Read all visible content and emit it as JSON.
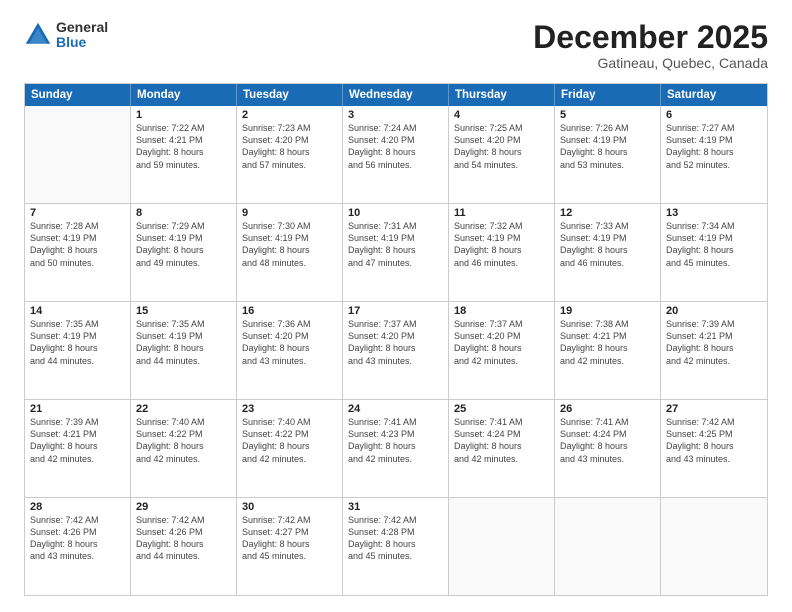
{
  "logo": {
    "general": "General",
    "blue": "Blue"
  },
  "title": "December 2025",
  "location": "Gatineau, Quebec, Canada",
  "header_days": [
    "Sunday",
    "Monday",
    "Tuesday",
    "Wednesday",
    "Thursday",
    "Friday",
    "Saturday"
  ],
  "weeks": [
    [
      {
        "day": "",
        "lines": []
      },
      {
        "day": "1",
        "lines": [
          "Sunrise: 7:22 AM",
          "Sunset: 4:21 PM",
          "Daylight: 8 hours",
          "and 59 minutes."
        ]
      },
      {
        "day": "2",
        "lines": [
          "Sunrise: 7:23 AM",
          "Sunset: 4:20 PM",
          "Daylight: 8 hours",
          "and 57 minutes."
        ]
      },
      {
        "day": "3",
        "lines": [
          "Sunrise: 7:24 AM",
          "Sunset: 4:20 PM",
          "Daylight: 8 hours",
          "and 56 minutes."
        ]
      },
      {
        "day": "4",
        "lines": [
          "Sunrise: 7:25 AM",
          "Sunset: 4:20 PM",
          "Daylight: 8 hours",
          "and 54 minutes."
        ]
      },
      {
        "day": "5",
        "lines": [
          "Sunrise: 7:26 AM",
          "Sunset: 4:19 PM",
          "Daylight: 8 hours",
          "and 53 minutes."
        ]
      },
      {
        "day": "6",
        "lines": [
          "Sunrise: 7:27 AM",
          "Sunset: 4:19 PM",
          "Daylight: 8 hours",
          "and 52 minutes."
        ]
      }
    ],
    [
      {
        "day": "7",
        "lines": [
          "Sunrise: 7:28 AM",
          "Sunset: 4:19 PM",
          "Daylight: 8 hours",
          "and 50 minutes."
        ]
      },
      {
        "day": "8",
        "lines": [
          "Sunrise: 7:29 AM",
          "Sunset: 4:19 PM",
          "Daylight: 8 hours",
          "and 49 minutes."
        ]
      },
      {
        "day": "9",
        "lines": [
          "Sunrise: 7:30 AM",
          "Sunset: 4:19 PM",
          "Daylight: 8 hours",
          "and 48 minutes."
        ]
      },
      {
        "day": "10",
        "lines": [
          "Sunrise: 7:31 AM",
          "Sunset: 4:19 PM",
          "Daylight: 8 hours",
          "and 47 minutes."
        ]
      },
      {
        "day": "11",
        "lines": [
          "Sunrise: 7:32 AM",
          "Sunset: 4:19 PM",
          "Daylight: 8 hours",
          "and 46 minutes."
        ]
      },
      {
        "day": "12",
        "lines": [
          "Sunrise: 7:33 AM",
          "Sunset: 4:19 PM",
          "Daylight: 8 hours",
          "and 46 minutes."
        ]
      },
      {
        "day": "13",
        "lines": [
          "Sunrise: 7:34 AM",
          "Sunset: 4:19 PM",
          "Daylight: 8 hours",
          "and 45 minutes."
        ]
      }
    ],
    [
      {
        "day": "14",
        "lines": [
          "Sunrise: 7:35 AM",
          "Sunset: 4:19 PM",
          "Daylight: 8 hours",
          "and 44 minutes."
        ]
      },
      {
        "day": "15",
        "lines": [
          "Sunrise: 7:35 AM",
          "Sunset: 4:19 PM",
          "Daylight: 8 hours",
          "and 44 minutes."
        ]
      },
      {
        "day": "16",
        "lines": [
          "Sunrise: 7:36 AM",
          "Sunset: 4:20 PM",
          "Daylight: 8 hours",
          "and 43 minutes."
        ]
      },
      {
        "day": "17",
        "lines": [
          "Sunrise: 7:37 AM",
          "Sunset: 4:20 PM",
          "Daylight: 8 hours",
          "and 43 minutes."
        ]
      },
      {
        "day": "18",
        "lines": [
          "Sunrise: 7:37 AM",
          "Sunset: 4:20 PM",
          "Daylight: 8 hours",
          "and 42 minutes."
        ]
      },
      {
        "day": "19",
        "lines": [
          "Sunrise: 7:38 AM",
          "Sunset: 4:21 PM",
          "Daylight: 8 hours",
          "and 42 minutes."
        ]
      },
      {
        "day": "20",
        "lines": [
          "Sunrise: 7:39 AM",
          "Sunset: 4:21 PM",
          "Daylight: 8 hours",
          "and 42 minutes."
        ]
      }
    ],
    [
      {
        "day": "21",
        "lines": [
          "Sunrise: 7:39 AM",
          "Sunset: 4:21 PM",
          "Daylight: 8 hours",
          "and 42 minutes."
        ]
      },
      {
        "day": "22",
        "lines": [
          "Sunrise: 7:40 AM",
          "Sunset: 4:22 PM",
          "Daylight: 8 hours",
          "and 42 minutes."
        ]
      },
      {
        "day": "23",
        "lines": [
          "Sunrise: 7:40 AM",
          "Sunset: 4:22 PM",
          "Daylight: 8 hours",
          "and 42 minutes."
        ]
      },
      {
        "day": "24",
        "lines": [
          "Sunrise: 7:41 AM",
          "Sunset: 4:23 PM",
          "Daylight: 8 hours",
          "and 42 minutes."
        ]
      },
      {
        "day": "25",
        "lines": [
          "Sunrise: 7:41 AM",
          "Sunset: 4:24 PM",
          "Daylight: 8 hours",
          "and 42 minutes."
        ]
      },
      {
        "day": "26",
        "lines": [
          "Sunrise: 7:41 AM",
          "Sunset: 4:24 PM",
          "Daylight: 8 hours",
          "and 43 minutes."
        ]
      },
      {
        "day": "27",
        "lines": [
          "Sunrise: 7:42 AM",
          "Sunset: 4:25 PM",
          "Daylight: 8 hours",
          "and 43 minutes."
        ]
      }
    ],
    [
      {
        "day": "28",
        "lines": [
          "Sunrise: 7:42 AM",
          "Sunset: 4:26 PM",
          "Daylight: 8 hours",
          "and 43 minutes."
        ]
      },
      {
        "day": "29",
        "lines": [
          "Sunrise: 7:42 AM",
          "Sunset: 4:26 PM",
          "Daylight: 8 hours",
          "and 44 minutes."
        ]
      },
      {
        "day": "30",
        "lines": [
          "Sunrise: 7:42 AM",
          "Sunset: 4:27 PM",
          "Daylight: 8 hours",
          "and 45 minutes."
        ]
      },
      {
        "day": "31",
        "lines": [
          "Sunrise: 7:42 AM",
          "Sunset: 4:28 PM",
          "Daylight: 8 hours",
          "and 45 minutes."
        ]
      },
      {
        "day": "",
        "lines": []
      },
      {
        "day": "",
        "lines": []
      },
      {
        "day": "",
        "lines": []
      }
    ]
  ]
}
